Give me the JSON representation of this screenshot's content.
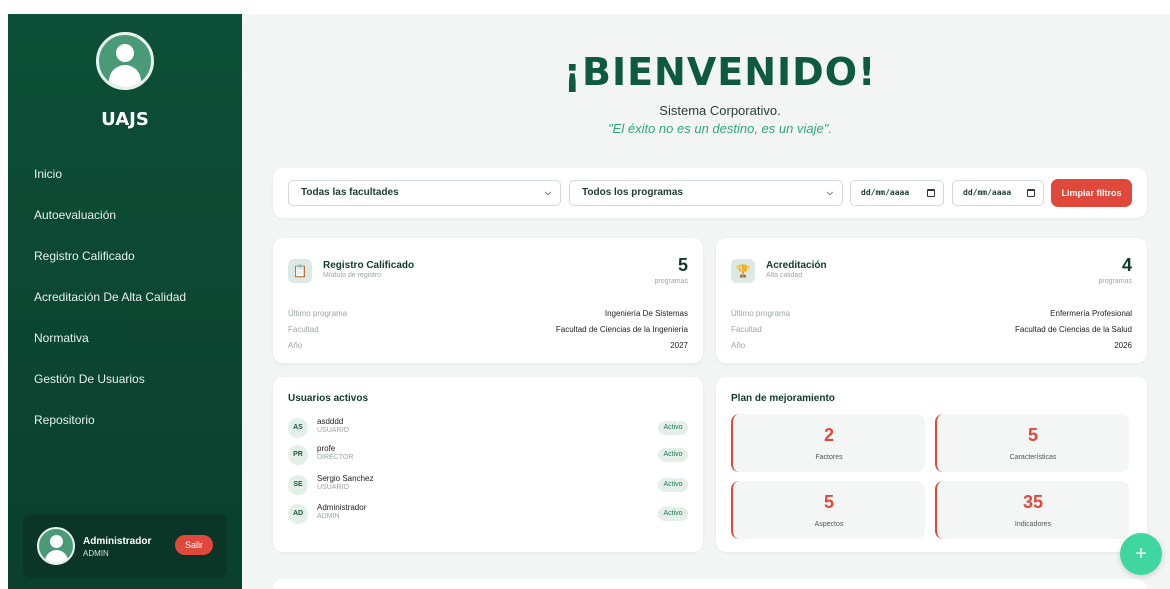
{
  "sidebar": {
    "brand": "UAJS",
    "nav": [
      {
        "label": "Inicio"
      },
      {
        "label": "Autoevaluación"
      },
      {
        "label": "Registro Calificado"
      },
      {
        "label": "Acreditación De Alta Calidad"
      },
      {
        "label": "Normativa"
      },
      {
        "label": "Gestión De Usuarios"
      },
      {
        "label": "Repositorio"
      }
    ],
    "user": {
      "name": "Administrador",
      "role": "ADMIN",
      "logout_label": "Salir"
    }
  },
  "hero": {
    "title": "¡BIENVENIDO!",
    "subtitle": "Sistema Corporativo.",
    "quote": "\"El éxito no es un destino, es un viaje\"."
  },
  "filters": {
    "faculty_select": "Todas las facultades",
    "program_select": "Todos los programas",
    "date_from_placeholder": "dd/mm/aaaa",
    "date_to_placeholder": "dd/mm/aaaa",
    "clear_label": "Limpiar filtros"
  },
  "cards": {
    "registro": {
      "title": "Registro Calificado",
      "subtitle": "Módulo de registro",
      "count": "5",
      "count_label": "programas",
      "rows": [
        {
          "label": "Último programa",
          "value": "Ingeniería De Sistemas"
        },
        {
          "label": "Facultad",
          "value": "Facultad de Ciencias de la Ingeniería"
        },
        {
          "label": "Año",
          "value": "2027"
        }
      ]
    },
    "acreditacion": {
      "title": "Acreditación",
      "subtitle": "Alta calidad",
      "count": "4",
      "count_label": "programas",
      "rows": [
        {
          "label": "Último programa",
          "value": "Enfermería Profesional"
        },
        {
          "label": "Facultad",
          "value": "Facultad de Ciencias de la Salud"
        },
        {
          "label": "Año",
          "value": "2026"
        }
      ]
    }
  },
  "usuarios": {
    "title": "Usuarios activos",
    "items": [
      {
        "initials": "AS",
        "name": "asdddd",
        "role": "USUARIO",
        "status": "Activo"
      },
      {
        "initials": "PR",
        "name": "profe",
        "role": "DIRECTOR",
        "status": "Activo"
      },
      {
        "initials": "SE",
        "name": "Sergio Sanchez",
        "role": "USUARIO",
        "status": "Activo"
      },
      {
        "initials": "AD",
        "name": "Administrador",
        "role": "ADMIN",
        "status": "Activo"
      }
    ]
  },
  "plan": {
    "title": "Plan de mejoramiento",
    "metrics": [
      {
        "value": "2",
        "label": "Factores"
      },
      {
        "value": "5",
        "label": "Características"
      },
      {
        "value": "5",
        "label": "Aspectos"
      },
      {
        "value": "35",
        "label": "Indicadores"
      }
    ]
  },
  "fab": {
    "label": "+"
  },
  "colors": {
    "primary": "#0d4f38",
    "accent": "#e0483b",
    "fab": "#3fd6a1",
    "quote": "#31a57d"
  },
  "icons": {
    "registro": "clipboard-icon",
    "acreditacion": "trophy-icon"
  }
}
